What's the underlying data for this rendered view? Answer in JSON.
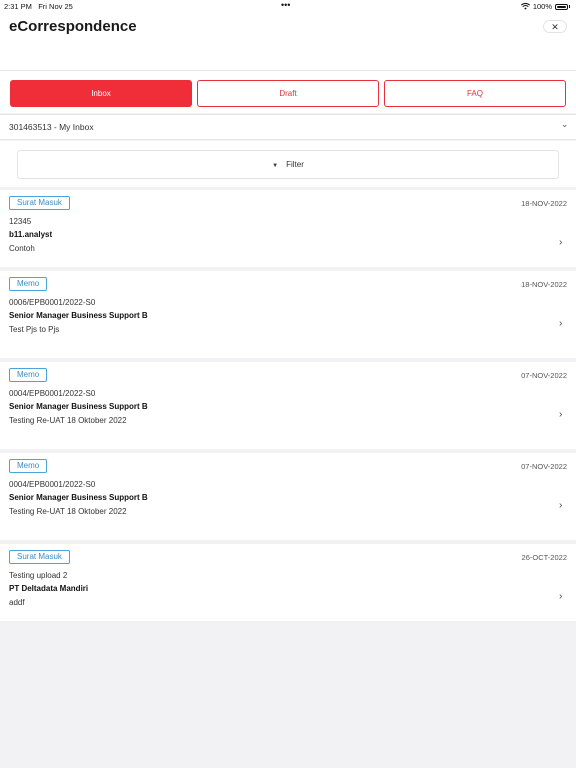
{
  "status_bar": {
    "time": "2:31 PM",
    "date": "Fri Nov 25",
    "dots": "•••",
    "battery": "100%",
    "wifi_icon": "wifi-icon",
    "battery_icon": "battery-icon"
  },
  "header": {
    "title": "eCorrespondence",
    "close_icon": "✕"
  },
  "tabs": [
    {
      "label": "Inbox",
      "active": true
    },
    {
      "label": "Draft",
      "active": false
    },
    {
      "label": "FAQ",
      "active": false
    }
  ],
  "inbox_select": {
    "value": "301463513 - My Inbox",
    "chevron": "⌄"
  },
  "filter": {
    "label": "Filter",
    "caret": "▼"
  },
  "items": [
    {
      "type": "Surat Masuk",
      "date": "18-NOV-2022",
      "number": "12345",
      "sender": "b11.analyst",
      "subject": "Contoh"
    },
    {
      "type": "Memo",
      "date": "18-NOV-2022",
      "number": "0006/EPB0001/2022-S0",
      "sender": "Senior Manager Business Support B",
      "subject": "Test Pjs to Pjs"
    },
    {
      "type": "Memo",
      "date": "07-NOV-2022",
      "number": "0004/EPB0001/2022-S0",
      "sender": "Senior Manager Business Support B",
      "subject": "Testing Re-UAT 18 Oktober 2022"
    },
    {
      "type": "Memo",
      "date": "07-NOV-2022",
      "number": "0004/EPB0001/2022-S0",
      "sender": "Senior Manager Business Support B",
      "subject": "Testing Re-UAT 18 Oktober 2022"
    },
    {
      "type": "Surat Masuk",
      "date": "26-OCT-2022",
      "number": "Testing upload 2",
      "sender": "PT Deltadata Mandiri",
      "subject": "addf"
    }
  ],
  "arrow_icon": "›",
  "colors": {
    "accent_red": "#ef2e3a",
    "badge_blue": "#49a4da",
    "background": "#f2f2f5"
  }
}
